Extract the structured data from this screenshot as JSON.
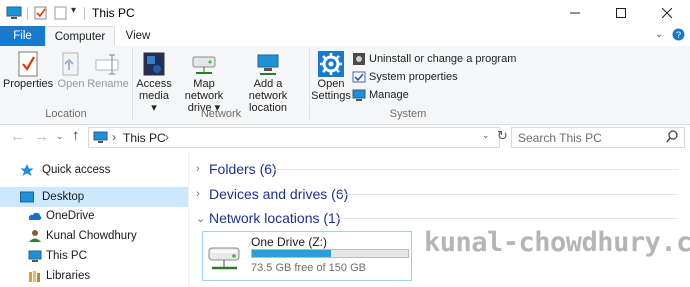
{
  "window": {
    "title": "This PC"
  },
  "tabs": {
    "file": "File",
    "computer": "Computer",
    "view": "View"
  },
  "ribbon": {
    "location": {
      "label": "Location",
      "properties": "Properties",
      "open": "Open",
      "rename": "Rename"
    },
    "network": {
      "label": "Network",
      "access_media": [
        "Access",
        "media ▾"
      ],
      "map_drive": [
        "Map network",
        "drive ▾"
      ],
      "add_location": [
        "Add a network",
        "location"
      ]
    },
    "system": {
      "label": "System",
      "open_settings": [
        "Open",
        "Settings"
      ],
      "uninstall": "Uninstall or change a program",
      "system_properties": "System properties",
      "manage": "Manage"
    }
  },
  "address": {
    "crumb": "This PC"
  },
  "search": {
    "placeholder": "Search This PC"
  },
  "nav": {
    "quick_access": "Quick access",
    "desktop": "Desktop",
    "onedrive": "OneDrive",
    "user": "Kunal Chowdhury",
    "this_pc": "This PC",
    "libraries": "Libraries"
  },
  "sections": {
    "folders": "Folders (6)",
    "devices": "Devices and drives (6)",
    "network": "Network locations (1)"
  },
  "drive": {
    "name": "One Drive (Z:)",
    "free": "73.5 GB free of 150 GB",
    "used_fraction": 0.51
  },
  "watermark": "kunal-chowdhury.com",
  "colors": {
    "accent": "#1979ca",
    "section_text": "#1e3287",
    "selection": "#cce8ff",
    "bar": "#26a0da"
  }
}
